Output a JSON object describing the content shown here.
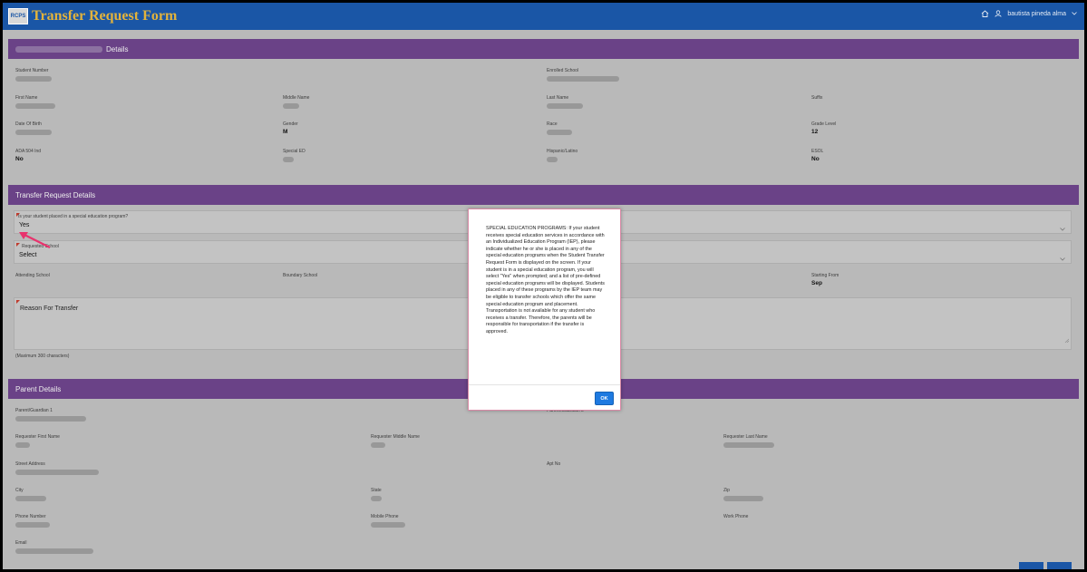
{
  "header": {
    "logo_text": "RCPS",
    "title": "Transfer Request Form",
    "user": "bautista pineda alma"
  },
  "student_section": {
    "title_suffix": "Details",
    "fields": {
      "student_number": {
        "label": "Student Number"
      },
      "enrolled_school": {
        "label": "Enrolled School"
      },
      "first_name": {
        "label": "First Name"
      },
      "middle_name": {
        "label": "Middle Name"
      },
      "last_name": {
        "label": "Last Name"
      },
      "suffix": {
        "label": "Suffix"
      },
      "dob": {
        "label": "Date Of Birth"
      },
      "gender": {
        "label": "Gender",
        "value": "M"
      },
      "race": {
        "label": "Race"
      },
      "grade_level": {
        "label": "Grade Level",
        "value": "12"
      },
      "ada": {
        "label": "ADA 504 Ind",
        "value": "No"
      },
      "special_ed": {
        "label": "Special ED"
      },
      "hispanic": {
        "label": "Hispanic/Latino"
      },
      "esol": {
        "label": "ESOL",
        "value": "No"
      }
    }
  },
  "transfer_section": {
    "title": "Transfer Request Details",
    "special_ed_question": {
      "label": "Is your student placed in a special education program?",
      "value": "Yes"
    },
    "requested_school": {
      "label": "Requested School",
      "value": "Select"
    },
    "attending_school": {
      "label": "Attending School"
    },
    "boundary_school": {
      "label": "Boundary School"
    },
    "starting_from": {
      "label": "Starting From",
      "value": "Sep"
    },
    "reason": {
      "placeholder": "Reason For Transfer",
      "hint": "(Maximum 300 characters)"
    }
  },
  "parent_section": {
    "title": "Parent Details",
    "fields": {
      "guardian1": {
        "label": "Parent/Guardian 1"
      },
      "guardian2": {
        "label": "Parent/Guardian 2"
      },
      "req_first": {
        "label": "Requester First Name"
      },
      "req_middle": {
        "label": "Requester Middle Name"
      },
      "req_last": {
        "label": "Requester Last Name"
      },
      "street": {
        "label": "Street Address"
      },
      "apt": {
        "label": "Apt No"
      },
      "city": {
        "label": "City"
      },
      "state": {
        "label": "State"
      },
      "zip": {
        "label": "Zip"
      },
      "phone": {
        "label": "Phone Number"
      },
      "mobile": {
        "label": "Mobile Phone"
      },
      "work": {
        "label": "Work Phone"
      },
      "email": {
        "label": "Email"
      }
    }
  },
  "modal": {
    "text": "SPECIAL EDUCATION PROGRAMS: If your student receives special education services in accordance with an Individualized Education Program (IEP), please indicate whether he or she is placed in any of the special education programs when the Student Transfer Request Form is displayed on the screen. If your student is in a special education program, you will select \"Yes\" when prompted; and a list of pre-defined special education programs will be displayed. Students placed in any of these programs by the IEP team may be eligible to transfer schools which offer the same special education program and placement. Transportation is not available for any student who receives a transfer. Therefore, the parents will be responsible for transportation if the transfer is approved.",
    "ok_label": "OK"
  },
  "colors": {
    "topbar": "#1a56a6",
    "title": "#e2b33c",
    "section": "#6a4287",
    "ok_button": "#1e7ae0",
    "arrow": "#e8336d"
  }
}
